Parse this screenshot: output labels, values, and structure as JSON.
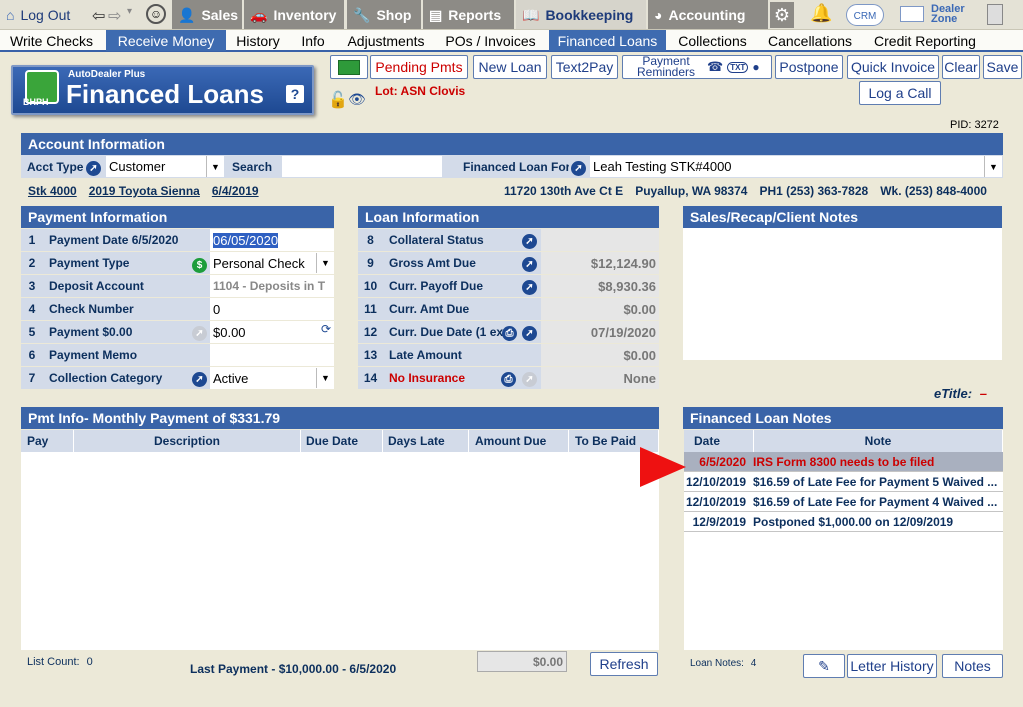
{
  "topnav": {
    "items": [
      {
        "label": "Log Out",
        "icon": "home-icon"
      },
      {
        "label": "Sales",
        "icon": "salesperson-icon"
      },
      {
        "label": "Inventory",
        "icon": "car-icon"
      },
      {
        "label": "Shop",
        "icon": "wrench-icon"
      },
      {
        "label": "Reports",
        "icon": "report-icon"
      },
      {
        "label": "Bookkeeping",
        "icon": "book-icon"
      },
      {
        "label": "Accounting",
        "icon": "pie-chart-icon"
      },
      {
        "label": "CRM",
        "icon": "crm-cloud-icon"
      },
      {
        "label": "Dealer Zone",
        "icon": "dealer-zone-icon"
      }
    ]
  },
  "subnav": {
    "items": [
      "Write Checks",
      "Receive Money",
      "History",
      "Info",
      "Adjustments",
      "POs / Invoices",
      "Financed Loans",
      "Collections",
      "Cancellations",
      "Credit Reporting"
    ]
  },
  "logo": {
    "brand": "AutoDealer Plus",
    "title": "Financed Loans",
    "badge": "BHPH",
    "help": "?"
  },
  "toolbar": {
    "pending_pmts": "Pending Pmts",
    "new_loan": "New Loan",
    "text2pay": "Text2Pay",
    "payment_reminders_1": "Payment",
    "payment_reminders_2": "Reminders",
    "postpone": "Postpone",
    "quick_invoice": "Quick Invoice",
    "clear": "Clear",
    "save": "Save",
    "log_a_call": "Log a Call",
    "lot": "Lot: ASN Clovis",
    "pid": "PID: 3272",
    "txt_badge": "TXT"
  },
  "account": {
    "header": "Account Information",
    "acct_type_label": "Acct Type",
    "acct_type_value": "Customer",
    "search_label": "Search",
    "search_value": "",
    "financed_for_label": "Financed Loan For",
    "financed_for_value": "Leah Testing STK#4000",
    "stock": "Stk 4000",
    "vehicle": "2019 Toyota Sienna",
    "date": "6/4/2019",
    "address": "11720 130th Ave Ct E",
    "city": "Puyallup, WA 98374",
    "phone": "PH1 (253) 363-7828",
    "work": "Wk. (253) 848-4000"
  },
  "payment": {
    "header": "Payment Information",
    "rows": [
      {
        "n": "1",
        "label": "Payment Date 6/5/2020",
        "value": "06/05/2020"
      },
      {
        "n": "2",
        "label": "Payment Type",
        "value": "Personal Check"
      },
      {
        "n": "3",
        "label": "Deposit Account",
        "value": "1104 - Deposits in T"
      },
      {
        "n": "4",
        "label": "Check Number",
        "value": "0"
      },
      {
        "n": "5",
        "label": "Payment $0.00",
        "value": "$0.00"
      },
      {
        "n": "6",
        "label": "Payment Memo",
        "value": ""
      },
      {
        "n": "7",
        "label": "Collection Category",
        "value": "Active"
      }
    ]
  },
  "loan": {
    "header": "Loan Information",
    "rows": [
      {
        "n": "8",
        "label": "Collateral Status",
        "value": ""
      },
      {
        "n": "9",
        "label": "Gross Amt Due",
        "value": "$12,124.90"
      },
      {
        "n": "10",
        "label": "Curr. Payoff Due",
        "value": "$8,930.36"
      },
      {
        "n": "11",
        "label": "Curr. Amt Due",
        "value": "$0.00"
      },
      {
        "n": "12",
        "label": "Curr. Due Date (1 ex",
        "value": "07/19/2020"
      },
      {
        "n": "13",
        "label": "Late Amount",
        "value": "$0.00"
      },
      {
        "n": "14",
        "label": "No Insurance",
        "value": "None"
      }
    ]
  },
  "sales_notes": {
    "header": "Sales/Recap/Client Notes"
  },
  "etitle": {
    "label": "eTitle:",
    "value": "–"
  },
  "pmt_info": {
    "header": "Pmt Info- Monthly Payment of $331.79",
    "columns": [
      "Pay",
      "Description",
      "Due Date",
      "Days Late",
      "Amount Due",
      "To Be Paid"
    ],
    "list_count_label": "List Count:",
    "list_count": "0",
    "last_payment": "Last Payment - $10,000.00 - 6/5/2020",
    "total": "$0.00",
    "refresh": "Refresh"
  },
  "loan_notes": {
    "header": "Financed Loan Notes",
    "columns": [
      "Date",
      "Note"
    ],
    "rows": [
      {
        "date": "6/5/2020",
        "note": "IRS Form 8300 needs to be filed"
      },
      {
        "date": "12/10/2019",
        "note": "$16.59 of Late Fee for Payment 5 Waived ..."
      },
      {
        "date": "12/10/2019",
        "note": "$16.59 of Late Fee for Payment 4 Waived ..."
      },
      {
        "date": "12/9/2019",
        "note": "Postponed $1,000.00 on 12/09/2019"
      }
    ],
    "count_label": "Loan Notes:",
    "count": "4",
    "letter_history": "Letter History",
    "notes": "Notes"
  },
  "colors": {
    "accent": "#3a64a8",
    "alert": "#cc0000",
    "highlight_row": "#a9b0bf"
  }
}
